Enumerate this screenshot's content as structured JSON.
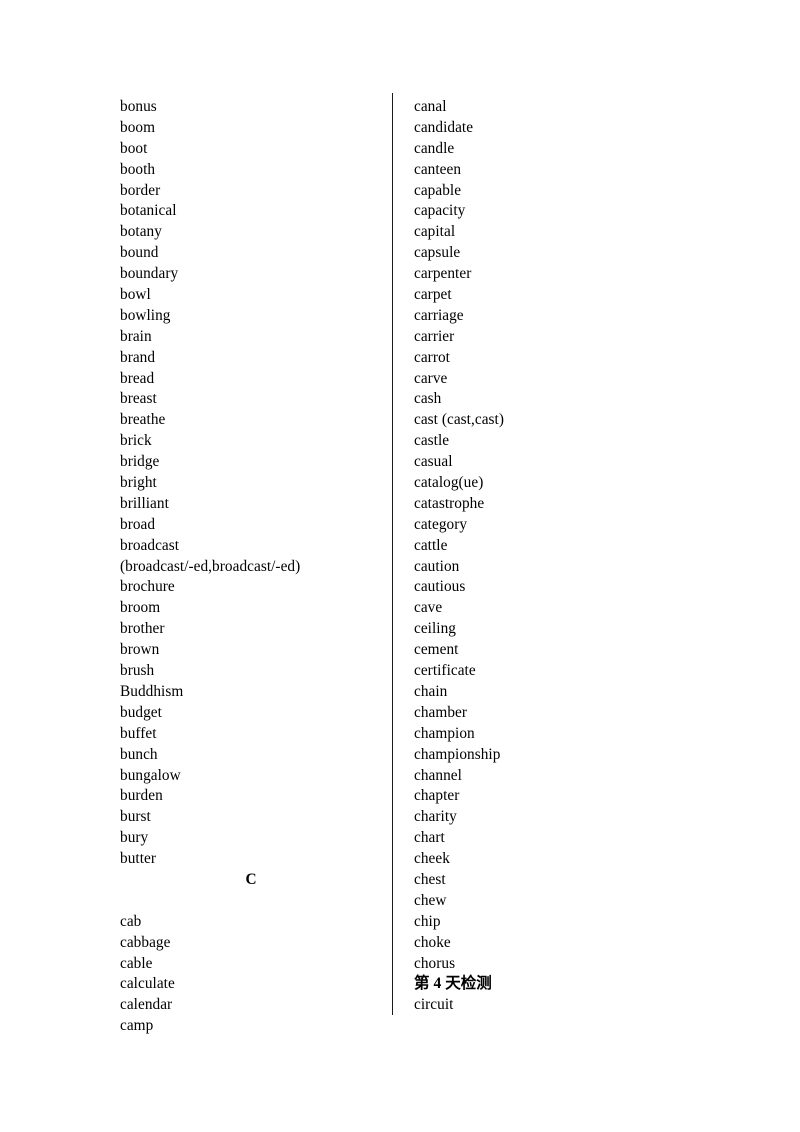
{
  "page": {
    "background_color": "#ffffff",
    "text_color": "#000000",
    "divider_color": "#1a1a1a"
  },
  "left_column": {
    "entries": [
      {
        "text": "bonus",
        "type": "word"
      },
      {
        "text": "boom",
        "type": "word"
      },
      {
        "text": "boot",
        "type": "word"
      },
      {
        "text": "booth",
        "type": "word"
      },
      {
        "text": "border",
        "type": "word"
      },
      {
        "text": "botanical",
        "type": "word"
      },
      {
        "text": "botany",
        "type": "word"
      },
      {
        "text": "bound",
        "type": "word"
      },
      {
        "text": "boundary",
        "type": "word"
      },
      {
        "text": "bowl",
        "type": "word"
      },
      {
        "text": "bowling",
        "type": "word"
      },
      {
        "text": "brain",
        "type": "word"
      },
      {
        "text": "brand",
        "type": "word"
      },
      {
        "text": "bread",
        "type": "word"
      },
      {
        "text": "breast",
        "type": "word"
      },
      {
        "text": "breathe",
        "type": "word"
      },
      {
        "text": "brick",
        "type": "word"
      },
      {
        "text": "bridge",
        "type": "word"
      },
      {
        "text": "bright",
        "type": "word"
      },
      {
        "text": "brilliant",
        "type": "word"
      },
      {
        "text": "broad",
        "type": "word"
      },
      {
        "text": "broadcast",
        "type": "word"
      },
      {
        "text": "(broadcast/-ed,broadcast/-ed)",
        "type": "word"
      },
      {
        "text": "brochure",
        "type": "word"
      },
      {
        "text": "broom",
        "type": "word"
      },
      {
        "text": "brother",
        "type": "word"
      },
      {
        "text": "brown",
        "type": "word"
      },
      {
        "text": "brush",
        "type": "word"
      },
      {
        "text": "Buddhism",
        "type": "word"
      },
      {
        "text": "budget",
        "type": "word"
      },
      {
        "text": "buffet",
        "type": "word"
      },
      {
        "text": "bunch",
        "type": "word"
      },
      {
        "text": "bungalow",
        "type": "word"
      },
      {
        "text": "burden",
        "type": "word"
      },
      {
        "text": "burst",
        "type": "word"
      },
      {
        "text": "bury",
        "type": "word"
      },
      {
        "text": "butter",
        "type": "word"
      },
      {
        "text": "C",
        "type": "section-heading"
      },
      {
        "text": "",
        "type": "blank"
      },
      {
        "text": "cab",
        "type": "word"
      },
      {
        "text": "cabbage",
        "type": "word"
      },
      {
        "text": "cable",
        "type": "word"
      },
      {
        "text": "calculate",
        "type": "word"
      },
      {
        "text": "calendar",
        "type": "word"
      },
      {
        "text": "camp",
        "type": "word"
      }
    ]
  },
  "right_column": {
    "entries": [
      {
        "text": "canal",
        "type": "word"
      },
      {
        "text": "candidate",
        "type": "word"
      },
      {
        "text": "candle",
        "type": "word"
      },
      {
        "text": "canteen",
        "type": "word"
      },
      {
        "text": "capable",
        "type": "word"
      },
      {
        "text": "capacity",
        "type": "word"
      },
      {
        "text": "capital",
        "type": "word"
      },
      {
        "text": "capsule",
        "type": "word"
      },
      {
        "text": "carpenter",
        "type": "word"
      },
      {
        "text": "carpet",
        "type": "word"
      },
      {
        "text": "carriage",
        "type": "word"
      },
      {
        "text": "carrier",
        "type": "word"
      },
      {
        "text": "carrot",
        "type": "word"
      },
      {
        "text": "carve",
        "type": "word"
      },
      {
        "text": "cash",
        "type": "word"
      },
      {
        "text": "cast (cast,cast)",
        "type": "word"
      },
      {
        "text": "castle",
        "type": "word"
      },
      {
        "text": "casual",
        "type": "word"
      },
      {
        "text": "catalog(ue)",
        "type": "word"
      },
      {
        "text": "catastrophe",
        "type": "word"
      },
      {
        "text": "category",
        "type": "word"
      },
      {
        "text": "cattle",
        "type": "word"
      },
      {
        "text": "caution",
        "type": "word"
      },
      {
        "text": "cautious",
        "type": "word"
      },
      {
        "text": "cave",
        "type": "word"
      },
      {
        "text": "ceiling",
        "type": "word"
      },
      {
        "text": "cement",
        "type": "word"
      },
      {
        "text": "certificate",
        "type": "word"
      },
      {
        "text": "chain",
        "type": "word"
      },
      {
        "text": "chamber",
        "type": "word"
      },
      {
        "text": "champion",
        "type": "word"
      },
      {
        "text": "championship",
        "type": "word"
      },
      {
        "text": "channel",
        "type": "word"
      },
      {
        "text": "chapter",
        "type": "word"
      },
      {
        "text": "charity",
        "type": "word"
      },
      {
        "text": "chart",
        "type": "word"
      },
      {
        "text": "cheek",
        "type": "word"
      },
      {
        "text": "chest",
        "type": "word"
      },
      {
        "text": "chew",
        "type": "word"
      },
      {
        "text": "chip",
        "type": "word"
      },
      {
        "text": "choke",
        "type": "word"
      },
      {
        "text": "chorus",
        "type": "word"
      },
      {
        "text": "第 4 天检测",
        "type": "day-marker"
      },
      {
        "text": "circuit",
        "type": "word"
      }
    ]
  }
}
